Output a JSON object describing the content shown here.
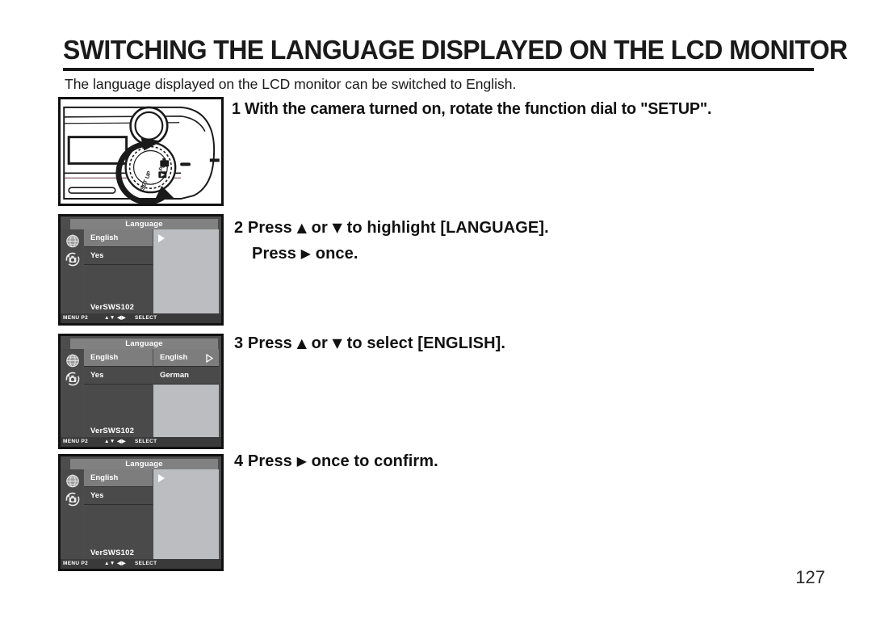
{
  "document": {
    "title": "SWITCHING THE LANGUAGE DISPLAYED ON THE LCD MONITOR",
    "intro": "The language displayed on the LCD monitor can be switched to English.",
    "page_number": "127"
  },
  "steps": [
    {
      "number": "1",
      "text": "With the camera turned on, rotate the function dial to \"SETUP\"."
    },
    {
      "number": "2",
      "line1_a": "Press",
      "up_glyph": "▲",
      "or": "or",
      "down_glyph": "▼",
      "line1_b": "to highlight [LANGUAGE].",
      "line2_a": "Press",
      "right_glyph": "▶",
      "line2_b": "once."
    },
    {
      "number": "3",
      "a": "Press",
      "up_glyph": "▲",
      "or": "or",
      "down_glyph": "▼",
      "b": "to select [ENGLISH]."
    },
    {
      "number": "4",
      "a": "Press",
      "right_glyph": "▶",
      "b": "once to confirm."
    }
  ],
  "camera_figure": {
    "caption": "camera-top-view-with-mode-dial",
    "dial_labels": {
      "setup": "SET UP",
      "pc": "PC"
    }
  },
  "lcd_screens": [
    {
      "id": "screen-1",
      "title": "Language",
      "menu_items": [
        "English",
        "Yes"
      ],
      "selected_index": 0,
      "version": "VerSWS102",
      "submenu_open": false,
      "submenu_items": [],
      "pane_cursor": "▶",
      "status_bar": {
        "menu": "MENU P2",
        "arrows": "▲▼ ◀▶",
        "select": "SELECT"
      }
    },
    {
      "id": "screen-2",
      "title": "Language",
      "menu_items": [
        "English",
        "Yes"
      ],
      "selected_index": 0,
      "version": "VerSWS102",
      "submenu_open": true,
      "submenu_items": [
        "English",
        "German"
      ],
      "submenu_selected_index": 0,
      "pane_cursor": "▷",
      "status_bar": {
        "menu": "MENU P2",
        "arrows": "▲▼ ◀▶",
        "select": "SELECT"
      }
    },
    {
      "id": "screen-3",
      "title": "Language",
      "menu_items": [
        "English",
        "Yes"
      ],
      "selected_index": 0,
      "version": "VerSWS102",
      "submenu_open": false,
      "submenu_items": [],
      "pane_cursor": "▶",
      "status_bar": {
        "menu": "MENU P2",
        "arrows": "▲▼ ◀▶",
        "select": "SELECT"
      }
    }
  ],
  "colors": {
    "ink": "#111111",
    "lcd_background": "#4d4d4d",
    "lcd_row": "#4a4a4a",
    "lcd_row_selected": "#7d7d7d",
    "lcd_title_bar": "#818181",
    "lcd_pane": "#bcbdc1",
    "lcd_status_bar": "#3a3a3a",
    "page_background": "#ffffff"
  }
}
